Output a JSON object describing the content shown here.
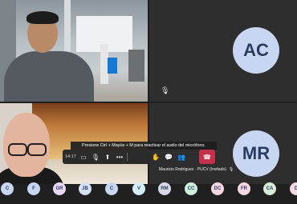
{
  "participants": {
    "top_right": {
      "initials": "AC"
    },
    "bottom_right": {
      "initials": "MR",
      "name": "Mauricio Rodríguez · PUCV (Invitado)"
    }
  },
  "meeting": {
    "time": "14:17",
    "tooltip": "Presione Ctrl + Mayús + M para reactivar el audio del micrófono."
  },
  "controls": {
    "icons": [
      "video-icon",
      "mic-off-icon",
      "share-icon",
      "more-icon",
      "raise-hand-icon",
      "chat-icon",
      "people-icon",
      "hangup-icon"
    ]
  },
  "strip": {
    "chips": [
      {
        "initials": "C",
        "color": "#c8d6f2"
      },
      {
        "initials": "F",
        "color": "#c8d6f2"
      },
      {
        "initials": "GR",
        "color": "#e8d8f6"
      },
      {
        "initials": "JB",
        "color": "#d6e0f4"
      },
      {
        "initials": "C",
        "color": "#c8d6f2"
      },
      {
        "initials": "V",
        "color": "#d4ecf6"
      },
      {
        "initials": "RM",
        "color": "#d9d9e8"
      },
      {
        "initials": "CC",
        "color": "#cfeede"
      },
      {
        "initials": "DC",
        "color": "#f6d7e2"
      },
      {
        "initials": "FR",
        "color": "#f6d7e2"
      },
      {
        "initials": "CA",
        "color": "#d6ecd6"
      },
      {
        "initials": "D",
        "color": "#f6d7e2"
      }
    ]
  }
}
